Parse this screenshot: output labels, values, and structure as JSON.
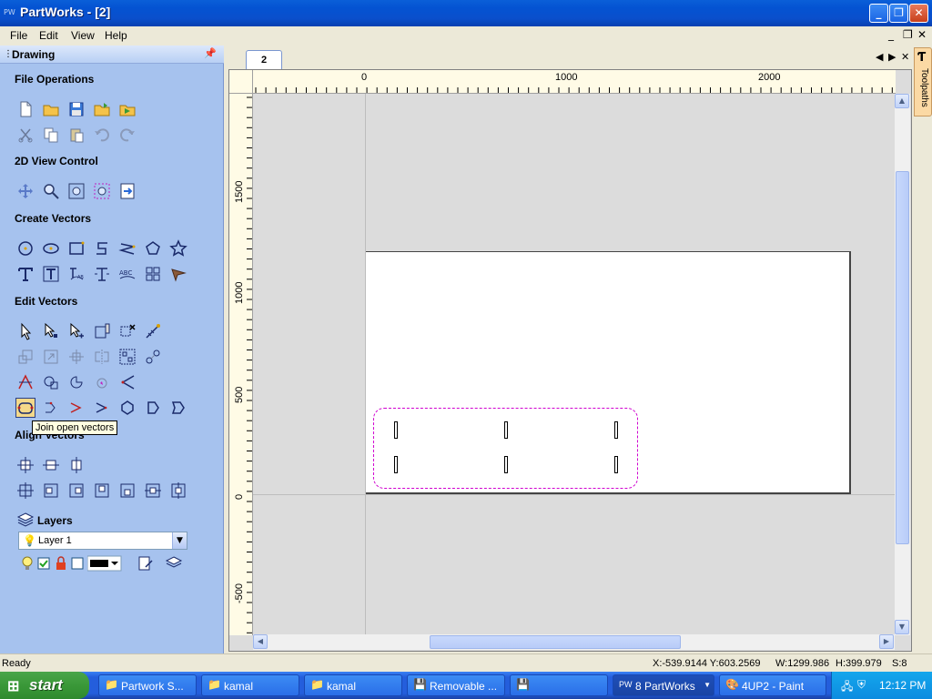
{
  "window": {
    "title": "PartWorks - [2]",
    "app_icon": "PW"
  },
  "menu": [
    "File",
    "Edit",
    "View",
    "Help"
  ],
  "panel": {
    "title": "Drawing",
    "sections": {
      "file_ops": "File Operations",
      "view_2d": "2D View Control",
      "create": "Create Vectors",
      "edit": "Edit Vectors",
      "align": "Align Vectors",
      "layers": "Layers"
    },
    "tooltip": "Join open vectors",
    "layer_select": "Layer 1"
  },
  "document": {
    "tab": "2"
  },
  "ruler": {
    "h_labels": [
      "0",
      "1000",
      "2000"
    ],
    "v_labels": [
      "1500",
      "1000",
      "500",
      "0",
      "-500"
    ]
  },
  "toolpaths_tab": "Toolpaths",
  "status": {
    "left": "Ready",
    "coords": "X:-539.9144 Y:603.2569",
    "width": "W:1299.986",
    "height": "H:399.979",
    "selected": "S:8"
  },
  "taskbar": {
    "start": "start",
    "tasks": [
      "Partwork S...",
      "kamal",
      "kamal",
      "Removable ...",
      "",
      "8 PartWorks",
      "4UP2 - Paint"
    ],
    "clock": "12:12 PM"
  },
  "colors": {
    "panel": "#a6c2ee",
    "selection": "#d000d0",
    "titlebar": "#0453d2"
  }
}
